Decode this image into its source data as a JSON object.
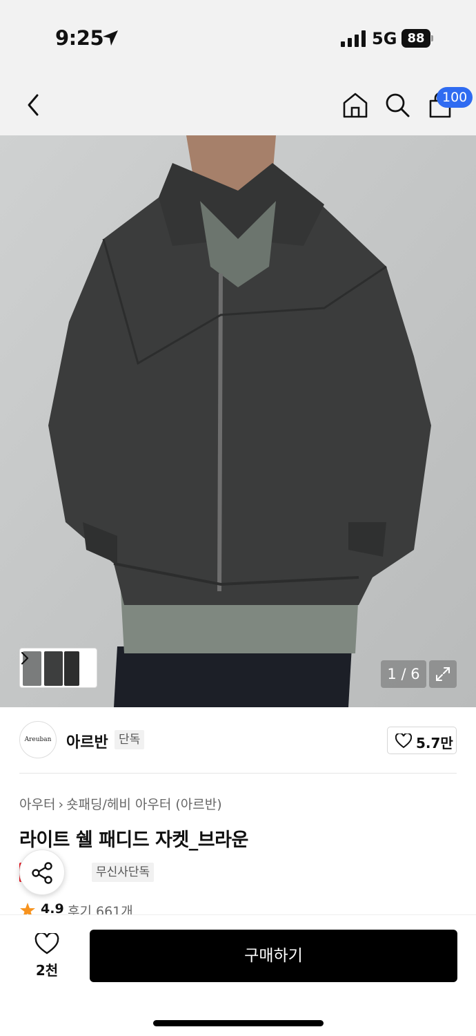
{
  "status_bar": {
    "time": "9:25",
    "network": "5G",
    "battery": "88"
  },
  "nav": {
    "cart_count": "100",
    "icons": [
      "back-icon",
      "home-icon",
      "search-icon",
      "cart-icon"
    ]
  },
  "gallery": {
    "page_indicator": "1 / 6"
  },
  "brand": {
    "logo_text": "Areuban",
    "name": "아르반",
    "tag": "단독",
    "like_count": "5.7만"
  },
  "product": {
    "breadcrumb": [
      "아우터",
      "숏패딩/헤비 아우터 (아르반)"
    ],
    "title": "라이트 쉘 패디드 자켓_브라운",
    "badges": {
      "sale": "세일",
      "exclusive": "무신사단독"
    },
    "rating": "4.9",
    "reviews": "후기 661개"
  },
  "bottom_bar": {
    "wish_count": "2천",
    "buy_label": "구매하기"
  },
  "colors": {
    "accent_blue": "#2f6bf1",
    "sale_red": "#e8141e",
    "star_orange": "#f7931e"
  }
}
